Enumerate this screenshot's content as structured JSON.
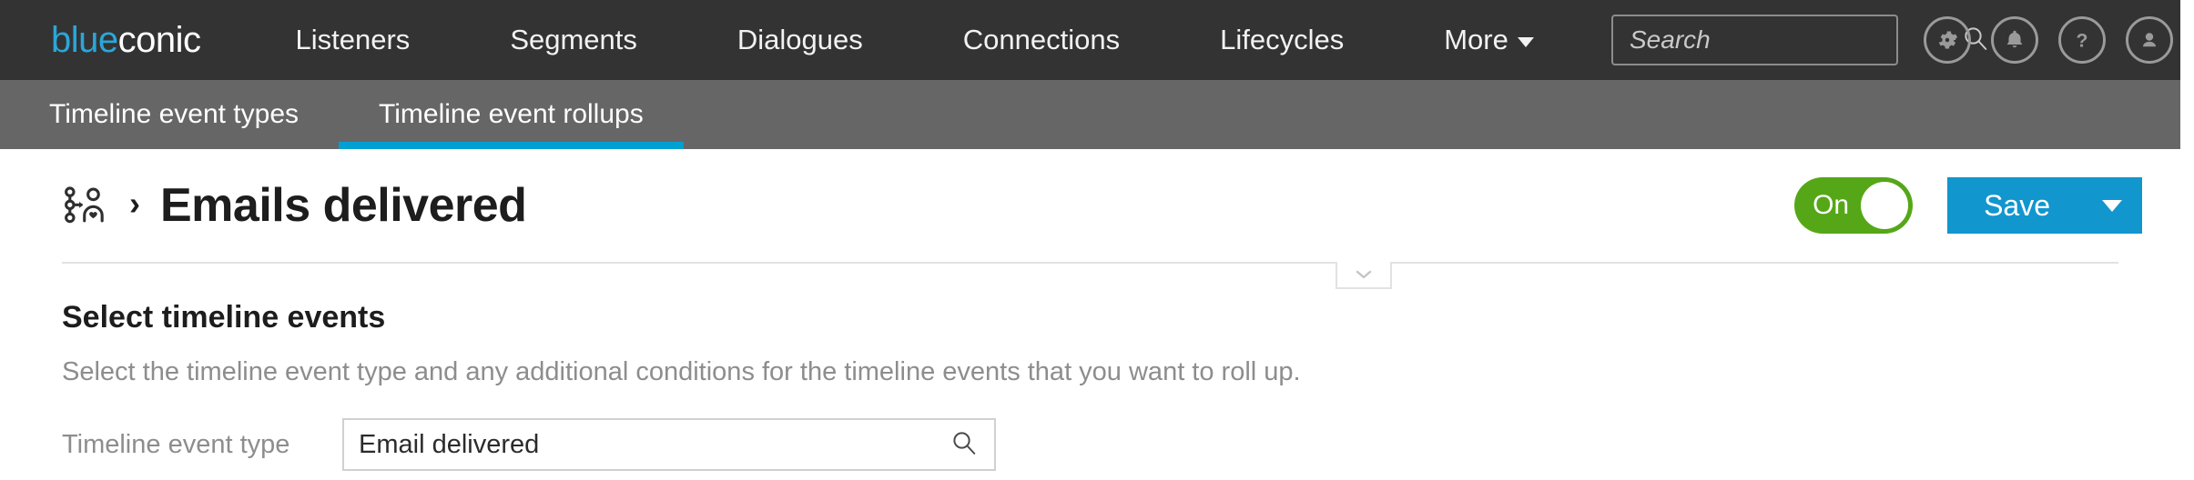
{
  "brand": {
    "logo_blue": "blue",
    "logo_white": "conic",
    "accent_blue": "#00a0d2",
    "brand_blue": "#2ba6d9",
    "save_blue": "#1296ce",
    "toggle_green": "#55a718",
    "header_dark": "#333333",
    "subnav_gray": "#666666"
  },
  "topnav": {
    "items": [
      {
        "label": "Listeners"
      },
      {
        "label": "Dialogues"
      },
      {
        "label": "Segments"
      },
      {
        "label": "Connections"
      },
      {
        "label": "Lifecycles"
      },
      {
        "label": "More"
      }
    ],
    "search": {
      "placeholder": "Search",
      "value": ""
    },
    "icons": [
      {
        "name": "gear-icon"
      },
      {
        "name": "bell-icon"
      },
      {
        "name": "help-icon"
      },
      {
        "name": "avatar-icon"
      }
    ]
  },
  "subnav": {
    "tabs": [
      {
        "label": "Timeline event types",
        "active": false
      },
      {
        "label": "Timeline event rollups",
        "active": true
      }
    ]
  },
  "title_bar": {
    "breadcrumb_icon": "timeline-event-rollup-icon",
    "separator": "›",
    "title": "Emails delivered",
    "toggle": {
      "label": "On",
      "state": "on"
    },
    "save": {
      "label": "Save",
      "dropdown_icon": "caret-down-icon"
    }
  },
  "divider": {
    "collapse_icon": "chevron-down-icon"
  },
  "section": {
    "heading": "Select timeline events",
    "description": "Select the timeline event type and any additional conditions for the timeline events that you want to roll up.",
    "field": {
      "label": "Timeline event type",
      "value": "Email delivered",
      "placeholder": "",
      "icon": "search-icon"
    }
  }
}
